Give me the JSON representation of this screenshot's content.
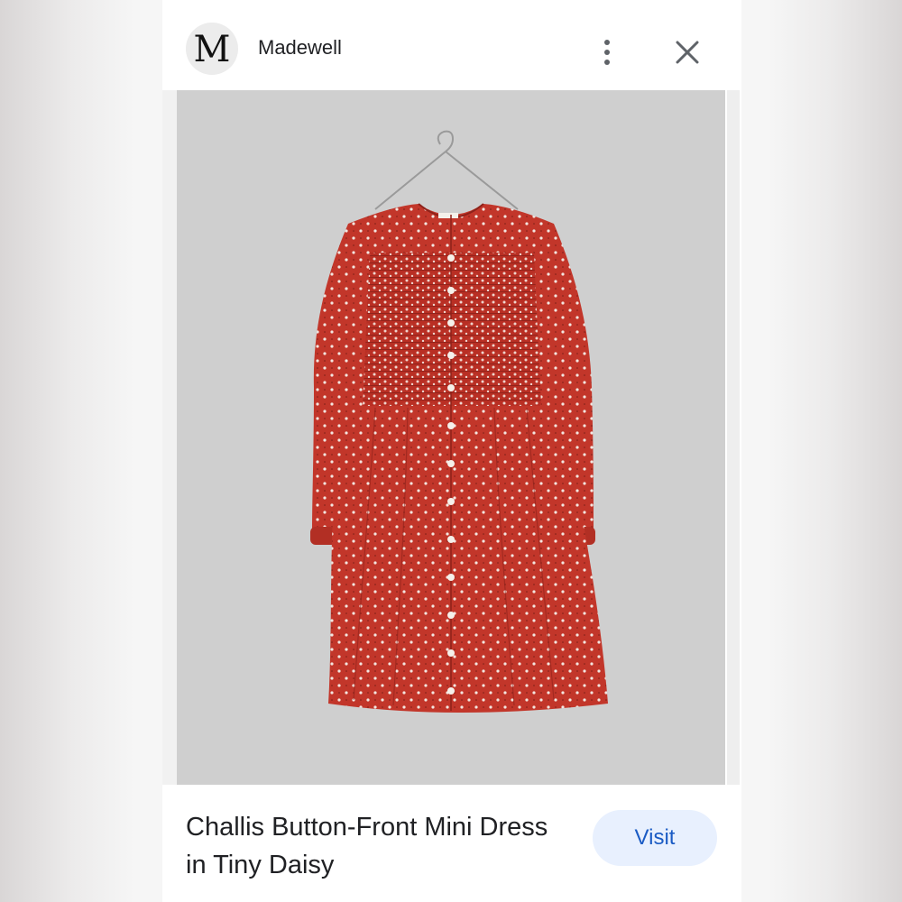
{
  "header": {
    "logo_letter": "M",
    "brand_name": "Madewell"
  },
  "product": {
    "title_line1": "Challis Button-Front Mini Dress",
    "title_line2": "in Tiny Daisy"
  },
  "actions": {
    "visit_label": "Visit"
  },
  "icons": {
    "more": "more-vert-icon",
    "close": "close-icon"
  },
  "colors": {
    "dress_red": "#c2362a",
    "image_background": "#cfcfcf",
    "visit_background": "#e8f0fe",
    "visit_text": "#1a5bc4"
  }
}
